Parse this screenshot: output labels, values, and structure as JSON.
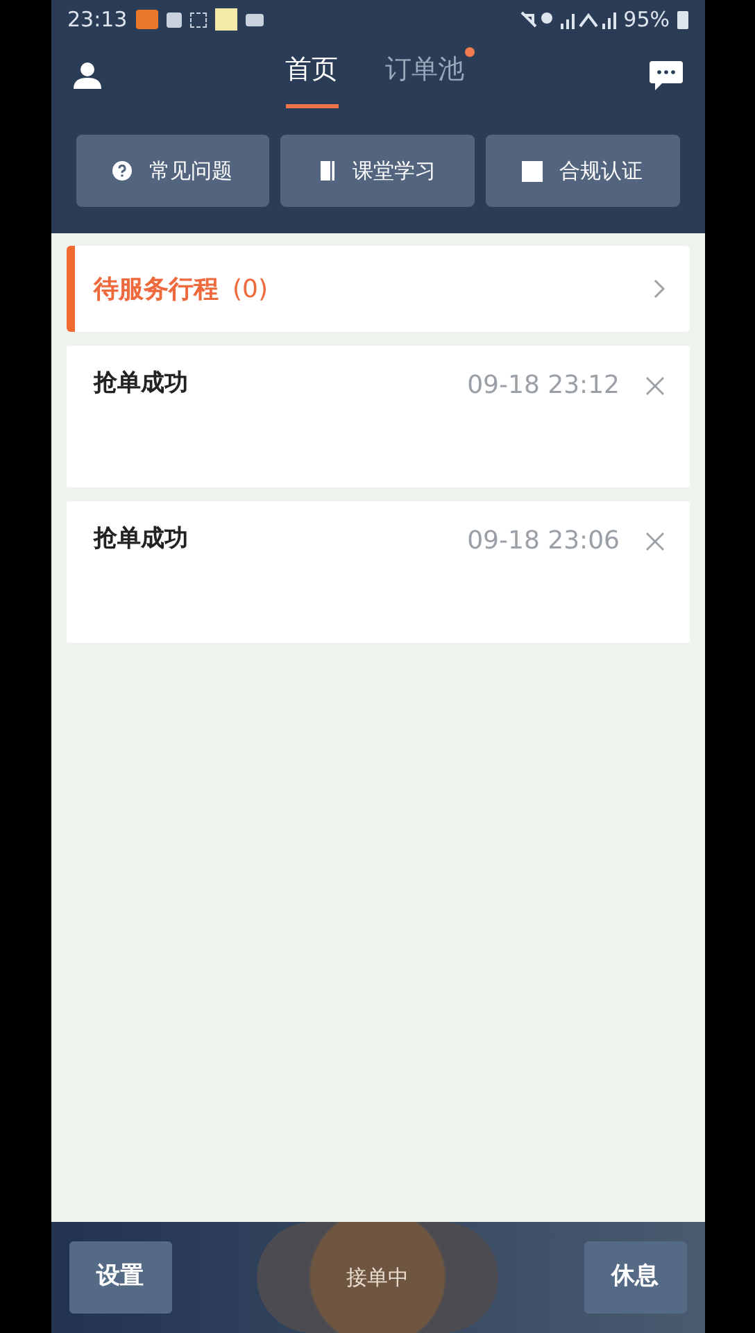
{
  "status_bar": {
    "time": "23:13",
    "battery": "95%"
  },
  "tabs": [
    {
      "label": "首页",
      "selected": true,
      "dot": false
    },
    {
      "label": "订单池",
      "selected": false,
      "dot": true
    }
  ],
  "quick_buttons": [
    {
      "label": "常见问题",
      "kind": "help"
    },
    {
      "label": "课堂学习",
      "kind": "book"
    },
    {
      "label": "合规认证",
      "kind": "square"
    }
  ],
  "pending": {
    "title": "待服务行程",
    "count": "(0)"
  },
  "messages": [
    {
      "title": "抢单成功",
      "time": "09-18 23:12"
    },
    {
      "title": "抢单成功",
      "time": "09-18 23:06"
    }
  ],
  "bottom_bar": {
    "left": "设置",
    "center": "接单中",
    "right": "休息"
  }
}
